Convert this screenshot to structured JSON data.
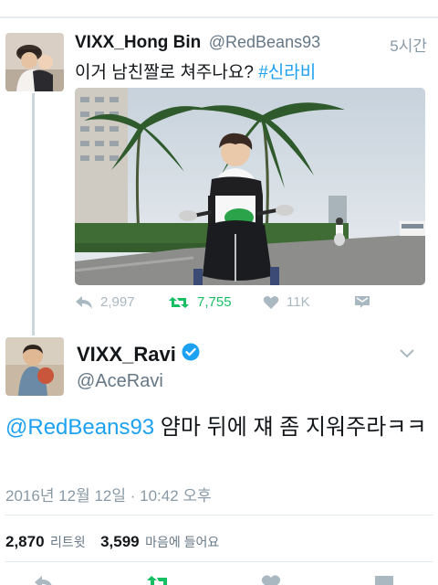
{
  "tweet1": {
    "name": "VIXX_Hong Bin",
    "handle": "@RedBeans93",
    "time": "5시간",
    "text": "이거 남친짤로 쳐주나요?",
    "hashtag": "#신라비",
    "actions": {
      "reply": "2,997",
      "retweet": "7,755",
      "like": "11K"
    }
  },
  "tweet2": {
    "name": "VIXX_Ravi",
    "handle": "@AceRavi",
    "mention": "@RedBeans93",
    "text_rest": " 얌마 뒤에 쟤 좀 지워주라ㅋㅋ",
    "timestamp": "2016년 12월 12일 · 10:42 오후",
    "stats": {
      "retweets_count": "2,870",
      "retweets_label": "리트윗",
      "likes_count": "3,599",
      "likes_label": "마음에 들어요"
    }
  },
  "colors": {
    "accent": "#1da1f2",
    "retweet_green": "#17bf63",
    "muted": "#8899a6"
  },
  "icons": [
    "reply-icon",
    "retweet-icon",
    "heart-icon",
    "message-icon",
    "verified-badge-icon",
    "chevron-down-icon"
  ]
}
